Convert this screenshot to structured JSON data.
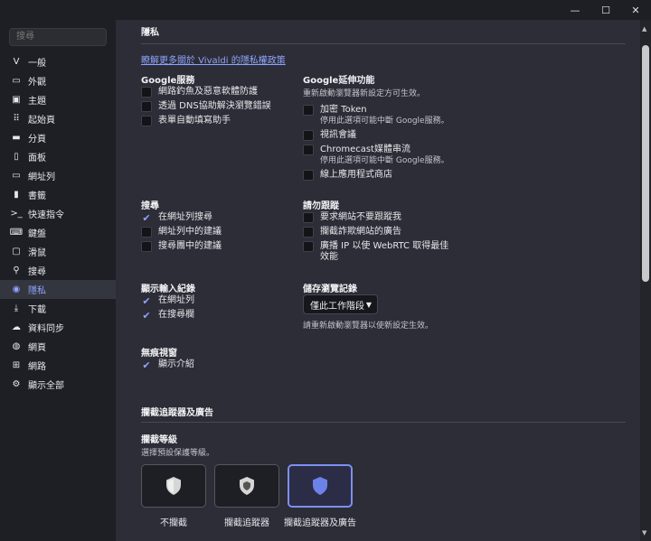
{
  "window": {
    "minimize_glyph": "—",
    "maximize_glyph": "☐",
    "close_glyph": "✕"
  },
  "sidebar": {
    "search_placeholder": "搜尋",
    "items": [
      {
        "label": "一般",
        "icon": "vivaldi-v-icon",
        "glyph": "V"
      },
      {
        "label": "外觀",
        "icon": "folder-icon",
        "glyph": "▭"
      },
      {
        "label": "主題",
        "icon": "theme-icon",
        "glyph": "▣"
      },
      {
        "label": "起始頁",
        "icon": "grid-icon",
        "glyph": "⠿"
      },
      {
        "label": "分頁",
        "icon": "tabs-icon",
        "glyph": "▬"
      },
      {
        "label": "面板",
        "icon": "panel-icon",
        "glyph": "▯"
      },
      {
        "label": "網址列",
        "icon": "address-bar-icon",
        "glyph": "▭"
      },
      {
        "label": "書籤",
        "icon": "bookmark-icon",
        "glyph": "▮"
      },
      {
        "label": "快速指令",
        "icon": "quick-command-icon",
        "glyph": ">_"
      },
      {
        "label": "鍵盤",
        "icon": "keyboard-icon",
        "glyph": "⌨"
      },
      {
        "label": "滑鼠",
        "icon": "mouse-icon",
        "glyph": "▢"
      },
      {
        "label": "搜尋",
        "icon": "search-icon",
        "glyph": "⚲"
      },
      {
        "label": "隱私",
        "icon": "eye-icon",
        "glyph": "◉",
        "active": true
      },
      {
        "label": "下載",
        "icon": "download-icon",
        "glyph": "⤓"
      },
      {
        "label": "資料同步",
        "icon": "cloud-icon",
        "glyph": "☁"
      },
      {
        "label": "網頁",
        "icon": "globe-icon",
        "glyph": "◍"
      },
      {
        "label": "網路",
        "icon": "network-icon",
        "glyph": "⊞"
      },
      {
        "label": "顯示全部",
        "icon": "gear-icon",
        "glyph": "⚙"
      }
    ]
  },
  "privacy": {
    "section_title": "隱私",
    "policy_link": "瞭解更多關於 Vivaldi 的隱私權政策",
    "google_services": {
      "title": "Google服務",
      "items": [
        {
          "label": "網路釣魚及惡意軟體防護",
          "checked": false
        },
        {
          "label": "透過 DNS協助解決瀏覽錯誤",
          "checked": false
        },
        {
          "label": "表單自動填寫助手",
          "checked": false
        }
      ]
    },
    "google_extensions": {
      "title": "Google延伸功能",
      "note": "重新啟動瀏覽器新設定方可生效。",
      "items": [
        {
          "label": "加密 Token",
          "sub": "停用此選項可能中斷 Google服務。",
          "checked": false
        },
        {
          "label": "視訊會議",
          "sub": "",
          "checked": false
        },
        {
          "label": "Chromecast媒體串流",
          "sub": "停用此選項可能中斷 Google服務。",
          "checked": false
        },
        {
          "label": "線上應用程式商店",
          "sub": "",
          "checked": false
        }
      ]
    },
    "search": {
      "title": "搜尋",
      "items": [
        {
          "label": "在網址列搜尋",
          "checked": true
        },
        {
          "label": "網址列中的建議",
          "checked": false
        },
        {
          "label": "搜尋團中的建議",
          "checked": false
        }
      ]
    },
    "do_not_track": {
      "title": "請勿跟蹤",
      "items": [
        {
          "label": "要求網站不要跟蹤我",
          "checked": false
        },
        {
          "label": "攔截詐欺網站的廣告",
          "checked": false
        },
        {
          "label": "廣播 IP 以使 WebRTC 取得最佳效能",
          "checked": false
        }
      ]
    },
    "typed_history": {
      "title": "顯示輸入紀錄",
      "items": [
        {
          "label": "在網址列",
          "checked": true
        },
        {
          "label": "在搜尋欄",
          "checked": true
        }
      ]
    },
    "browsing_history": {
      "title": "儲存瀏覽記錄",
      "selected": "僅此工作階段",
      "note": "請重新啟動瀏覽器以使新設定生效。"
    },
    "private_window": {
      "title": "無痕視窗",
      "items": [
        {
          "label": "顯示介紹",
          "checked": true
        }
      ]
    }
  },
  "tracker_blocking": {
    "section_title": "攔截追蹤器及廣告",
    "level_title": "攔截等級",
    "level_note": "選擇預設保護等級。",
    "options": [
      {
        "label": "不攔截",
        "selected": false
      },
      {
        "label": "攔截追蹤器",
        "selected": false
      },
      {
        "label": "攔截追蹤器及廣告",
        "selected": true
      }
    ]
  },
  "colors": {
    "accent": "#8fa4ff",
    "sidebar_bg": "#1e1f25",
    "content_bg": "#2c2d36"
  }
}
